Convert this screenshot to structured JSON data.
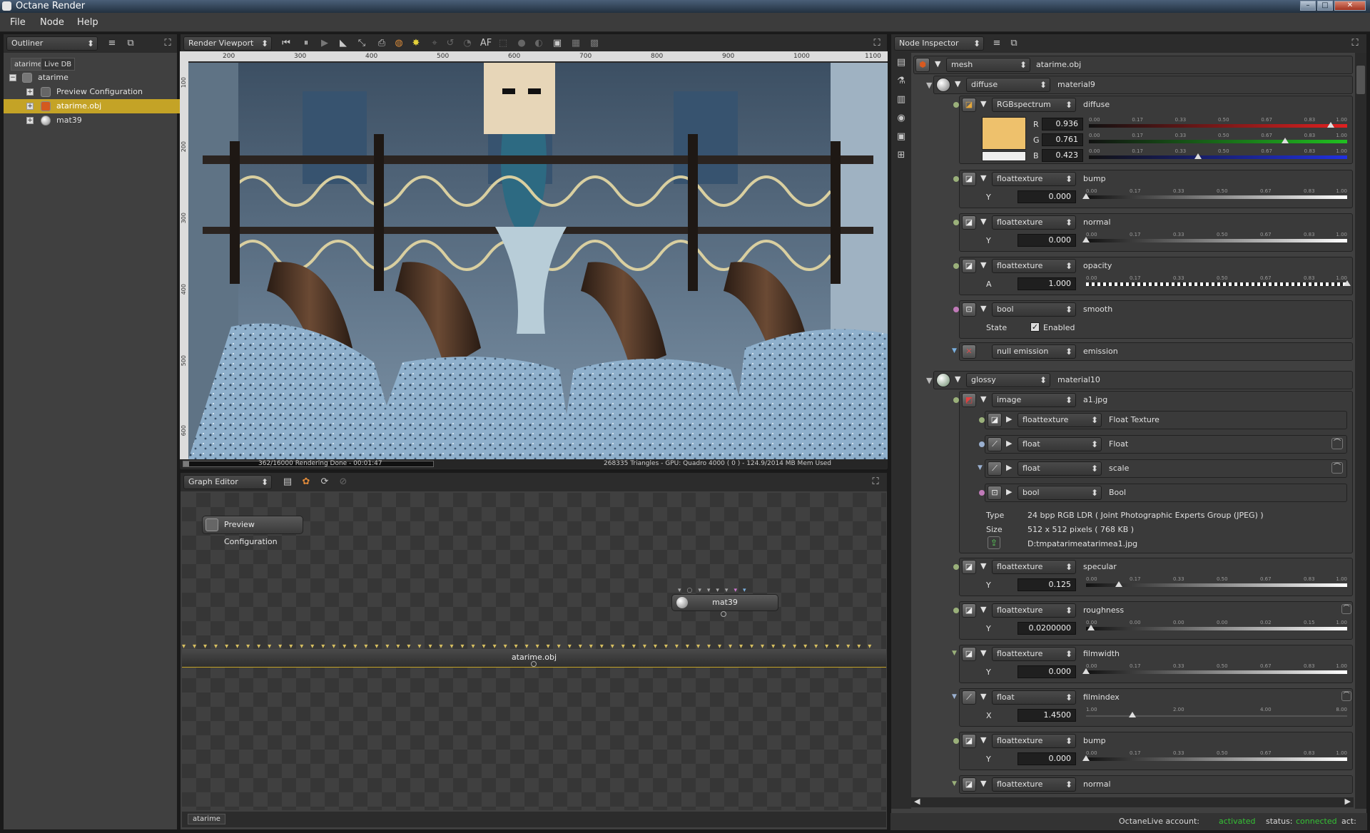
{
  "app": {
    "title": "Octane Render"
  },
  "menu": [
    "File",
    "Node",
    "Help"
  ],
  "outliner": {
    "panel": "Outliner",
    "tabs": [
      "atarime",
      "Live DB"
    ],
    "items": [
      {
        "label": "atarime",
        "level": 0
      },
      {
        "label": "Preview Configuration",
        "level": 1
      },
      {
        "label": "atarime.obj",
        "level": 1,
        "selected": true
      },
      {
        "label": "mat39",
        "level": 1
      }
    ]
  },
  "viewport": {
    "panel": "Render Viewport",
    "af_label": "AF",
    "ruler_x": [
      "200",
      "300",
      "400",
      "500",
      "600",
      "700",
      "800",
      "900",
      "1000",
      "1100"
    ],
    "ruler_y": [
      "100",
      "200",
      "300",
      "400",
      "500",
      "600"
    ],
    "status_left": "362/16000 Rendering Done - 00:01:47",
    "status_right": "268335 Triangles - GPU: Quadro 4000 ( 0 ) - 124.9/2014 MB Mem Used",
    "progress": 0.0226
  },
  "graph": {
    "panel": "Graph Editor",
    "nodes": {
      "preview": "Preview Configuration",
      "mat": "mat39",
      "obj": "atarime.obj"
    },
    "footer_tab": "atarime"
  },
  "inspector": {
    "panel": "Node Inspector",
    "mesh": {
      "type": "mesh",
      "name": "atarime.obj"
    },
    "material9": {
      "type": "diffuse",
      "name": "material9"
    },
    "rgb": {
      "type": "RGBspectrum",
      "name": "diffuse",
      "r": "0.936",
      "g": "0.761",
      "b": "0.423",
      "swatch": "#eec16c",
      "ticks": [
        "0.00",
        "0.17",
        "0.33",
        "0.50",
        "0.67",
        "0.83",
        "1.00"
      ]
    },
    "bump": {
      "type": "floattexture",
      "name": "bump",
      "ch": "Y",
      "value": "0.000",
      "level": 0
    },
    "normal": {
      "type": "floattexture",
      "name": "normal",
      "ch": "Y",
      "value": "0.000",
      "level": 0
    },
    "opacity": {
      "type": "floattexture",
      "name": "opacity",
      "ch": "A",
      "value": "1.000",
      "level": 1
    },
    "smooth": {
      "type": "bool",
      "name": "smooth",
      "state_label": "State",
      "enabled_label": "Enabled"
    },
    "emission": {
      "type": "null emission",
      "name": "emission"
    },
    "material10": {
      "type": "glossy",
      "name": "material10"
    },
    "image": {
      "type": "image",
      "name": "a1.jpg",
      "subs": [
        {
          "type": "floattexture",
          "name": "Float Texture"
        },
        {
          "type": "float",
          "name": "Float"
        },
        {
          "type": "float",
          "name": "scale"
        },
        {
          "type": "bool",
          "name": "Bool"
        }
      ],
      "type_label": "Type",
      "type_value": "24 bpp RGB LDR ( Joint Photographic Experts Group (JPEG) )",
      "size_label": "Size",
      "size_value": "512 x 512 pixels ( 768 KB )",
      "path": "D:tmpatarimeatarimea1.jpg"
    },
    "specular": {
      "type": "floattexture",
      "name": "specular",
      "ch": "Y",
      "value": "0.125",
      "level": 0.125
    },
    "roughness": {
      "type": "floattexture",
      "name": "roughness",
      "ch": "Y",
      "value": "0.0200000",
      "level": 0.02,
      "ticks": [
        "0.00",
        "0.00",
        "0.00",
        "0.00",
        "0.02",
        "0.15",
        "1.00"
      ]
    },
    "filmwidth": {
      "type": "floattexture",
      "name": "filmwidth",
      "ch": "Y",
      "value": "0.000",
      "level": 0
    },
    "filmindex": {
      "type": "float",
      "name": "filmindex",
      "ch": "X",
      "value": "1.4500",
      "ticks": [
        "1.00",
        "2.00",
        "4.00",
        "8.00"
      ]
    },
    "bump2": {
      "type": "floattexture",
      "name": "bump",
      "ch": "Y",
      "value": "0.000",
      "level": 0
    },
    "normal2": {
      "type": "floattexture",
      "name": "normal"
    }
  },
  "statusbar": {
    "account_label": "OctaneLive account:",
    "account_value": "activated",
    "status_label": "status:",
    "status_value": "connected",
    "act_label": "act:"
  },
  "colors": {
    "selected": "#c4a326",
    "activated": "#35c235"
  }
}
